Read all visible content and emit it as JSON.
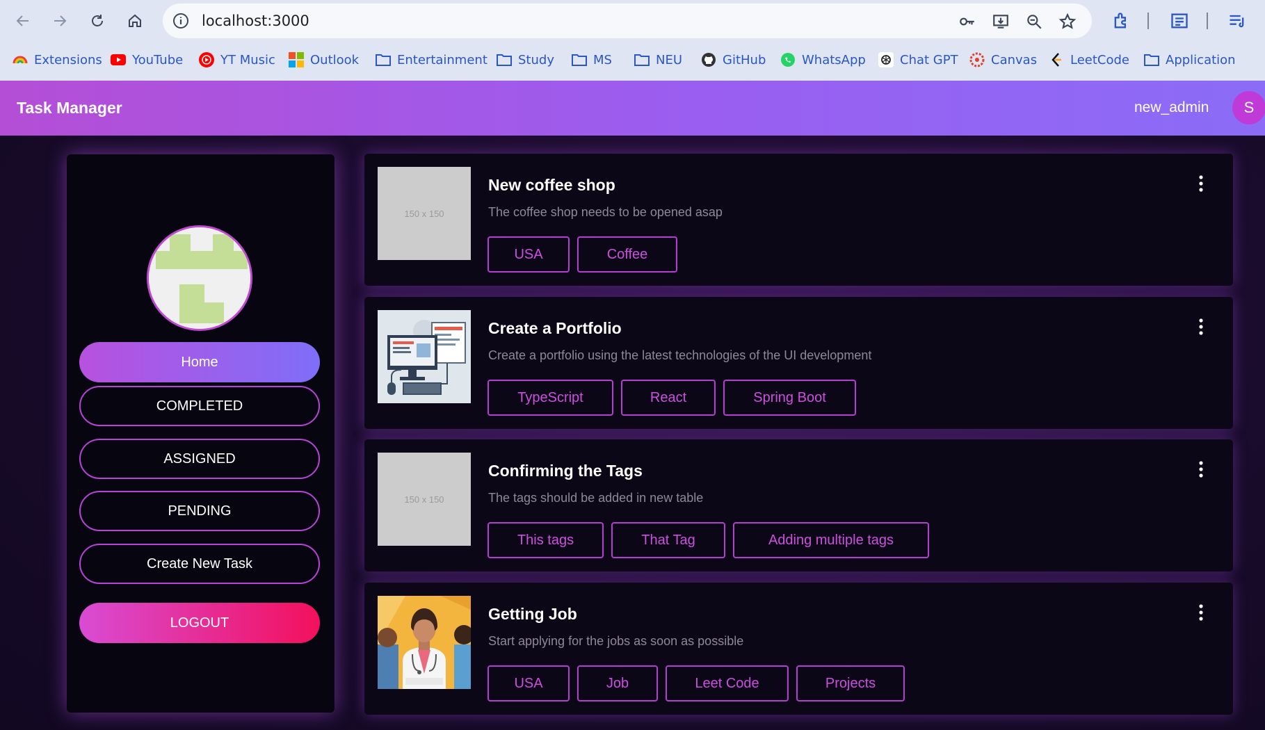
{
  "browser": {
    "url": "localhost:3000",
    "bookmarks": [
      {
        "label": "Extensions",
        "icon": "rainbow-icon"
      },
      {
        "label": "YouTube",
        "icon": "youtube-icon"
      },
      {
        "label": "YT Music",
        "icon": "yt-music-icon"
      },
      {
        "label": "Outlook",
        "icon": "microsoft-icon"
      },
      {
        "label": "Entertainment",
        "icon": "folder-icon"
      },
      {
        "label": "Study",
        "icon": "folder-icon"
      },
      {
        "label": "MS",
        "icon": "folder-icon"
      },
      {
        "label": "NEU",
        "icon": "folder-icon"
      },
      {
        "label": "GitHub",
        "icon": "github-icon"
      },
      {
        "label": "WhatsApp",
        "icon": "whatsapp-icon"
      },
      {
        "label": "Chat GPT",
        "icon": "chatgpt-icon"
      },
      {
        "label": "Canvas",
        "icon": "canvas-icon"
      },
      {
        "label": "LeetCode",
        "icon": "leetcode-icon"
      },
      {
        "label": "Application",
        "icon": "folder-icon"
      }
    ]
  },
  "header": {
    "title": "Task Manager",
    "username": "new_admin",
    "avatar_initial": "S"
  },
  "sidebar": {
    "home": "Home",
    "completed": "COMPLETED",
    "assigned": "ASSIGNED",
    "pending": "PENDING",
    "create": "Create New Task",
    "logout": "LOGOUT"
  },
  "tasks": [
    {
      "title": "New coffee shop",
      "description": "The coffee shop needs to be opened asap",
      "image": "placeholder",
      "placeholder_text": "150 x 150",
      "tags": [
        "USA",
        "Coffee"
      ]
    },
    {
      "title": "Create a Portfolio",
      "description": "Create a portfolio using the latest technologies of the UI development",
      "image": "computer-illustration",
      "tags": [
        "TypeScript",
        "React",
        "Spring Boot"
      ]
    },
    {
      "title": "Confirming the Tags",
      "description": "The tags should be added in new table",
      "image": "placeholder",
      "placeholder_text": "150 x 150",
      "tags": [
        "This tags",
        "That Tag",
        "Adding multiple tags"
      ]
    },
    {
      "title": "Getting Job",
      "description": "Start applying for the jobs as soon as possible",
      "image": "doctor-illustration",
      "tags": [
        "USA",
        "Job",
        "Leet Code",
        "Projects"
      ]
    }
  ],
  "colors": {
    "accent": "#b743d8",
    "header_start": "#b44ed6",
    "header_end": "#8b6cf7",
    "logout_end": "#f3105d",
    "tag_text": "#cd4fdf"
  }
}
